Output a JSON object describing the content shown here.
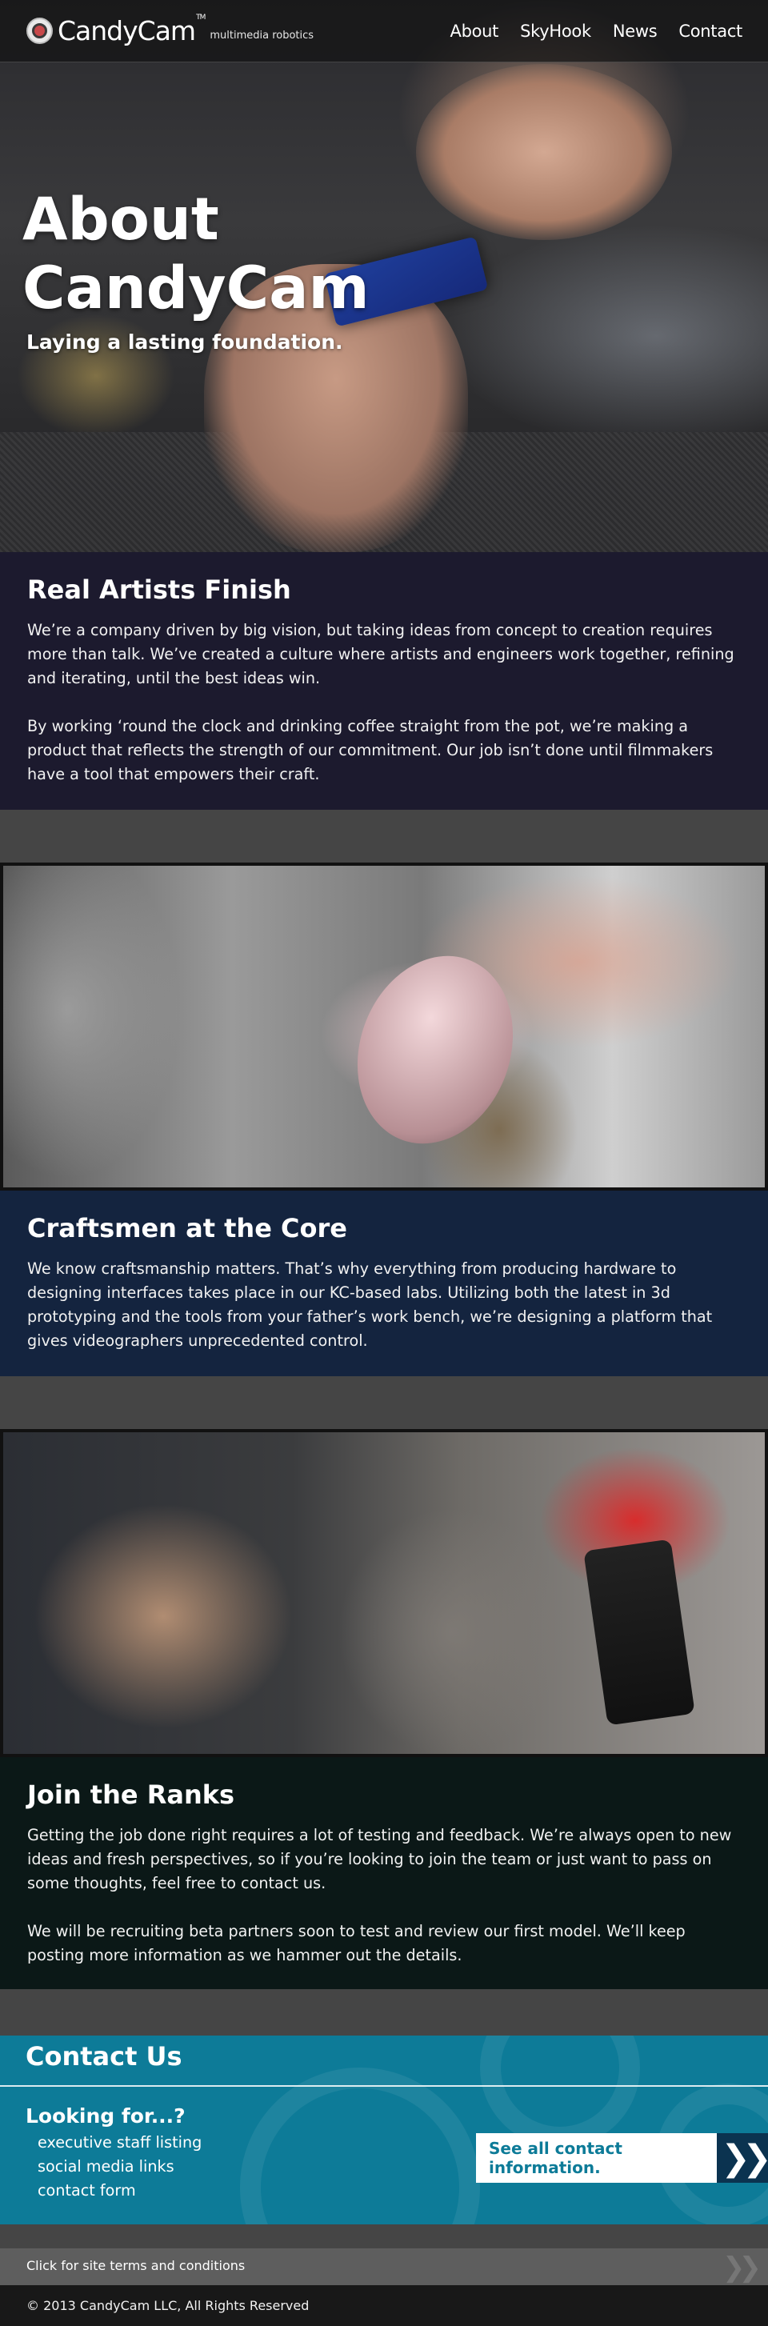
{
  "header": {
    "logo_text": "CandyCam",
    "logo_tm": "TM",
    "tagline": "multimedia robotics",
    "nav": [
      {
        "label": "About"
      },
      {
        "label": "SkyHook"
      },
      {
        "label": "News"
      },
      {
        "label": "Contact"
      }
    ]
  },
  "hero": {
    "title": "About CandyCam",
    "subtitle": "Laying a lasting foundation."
  },
  "sections": {
    "real_artists": {
      "heading": "Real Artists Finish",
      "paragraphs": [
        "We’re a company driven by big vision, but taking ideas from concept to creation requires more than talk. We’ve created a culture where artists and engineers work together, refining and iterating, until the best ideas win.",
        "By working ‘round the clock and drinking coffee straight from the pot, we’re making a product that reflects the strength of our commitment. Our job isn’t done until filmmakers have a tool that empowers their craft."
      ]
    },
    "craftsmen": {
      "heading": "Craftsmen at the Core",
      "paragraphs": [
        "We know craftsmanship matters. That’s why everything from producing hardware to designing interfaces takes place in our KC-based labs. Utilizing both the latest in 3d prototyping and the tools from your father’s work bench, we’re designing a platform that gives videographers unprecedented control."
      ]
    },
    "join": {
      "heading": "Join the Ranks",
      "paragraphs": [
        "Getting the job done right requires a lot of testing and feedback. We’re always open to new ideas and fresh perspectives, so if you’re looking to join the team or just want to pass on some thoughts, feel free to contact us.",
        "We will be recruiting beta partners soon to test and review our first model. We’ll keep posting more information as we hammer out the details."
      ]
    }
  },
  "contact": {
    "title": "Contact Us",
    "looking_for": "Looking for...?",
    "items": [
      "executive staff listing",
      "social media links",
      "contact form"
    ],
    "cta_label": "See all contact information.",
    "cta_icon": "double-chevron-right-icon"
  },
  "footer": {
    "terms": "Click for site terms and conditions",
    "copyright": "© 2013 CandyCam LLC, All Rights Reserved"
  },
  "colors": {
    "section1_bg": "#1c1a2e",
    "section2_bg": "#14243f",
    "section3_bg": "#0b1817",
    "contact_bg": "#0d7b98",
    "cta_arrow_bg": "#0b3350",
    "page_bg": "#454545"
  }
}
